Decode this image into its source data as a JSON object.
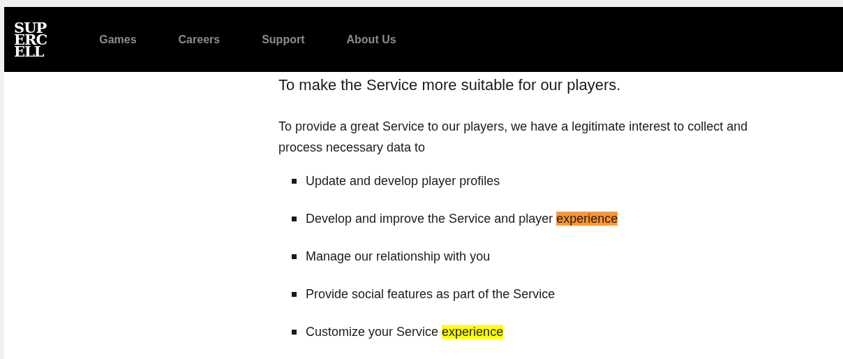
{
  "header": {
    "logo_lines": [
      "SUP",
      "ERC",
      "ELL"
    ],
    "nav": [
      "Games",
      "Careers",
      "Support",
      "About Us"
    ]
  },
  "content": {
    "heading": "To make the Service more suitable for our players.",
    "paragraph": "To provide a great Service to our players, we have a legitimate interest to collect and process necessary data to",
    "list": [
      {
        "parts": [
          {
            "text": "Update and develop player profiles",
            "highlighted": false,
            "selected": false
          }
        ]
      },
      {
        "parts": [
          {
            "text": "Develop and improve the Service and player ",
            "highlighted": false,
            "selected": false
          },
          {
            "text": "experience",
            "highlighted": true,
            "selected": true
          }
        ]
      },
      {
        "parts": [
          {
            "text": "Manage our relationship with you",
            "highlighted": false,
            "selected": false
          }
        ]
      },
      {
        "parts": [
          {
            "text": "Provide social features as part of the Service",
            "highlighted": false,
            "selected": false
          }
        ]
      },
      {
        "parts": [
          {
            "text": "Customize your Service ",
            "highlighted": false,
            "selected": false
          },
          {
            "text": "experience",
            "highlighted": true,
            "selected": false
          }
        ]
      }
    ]
  }
}
